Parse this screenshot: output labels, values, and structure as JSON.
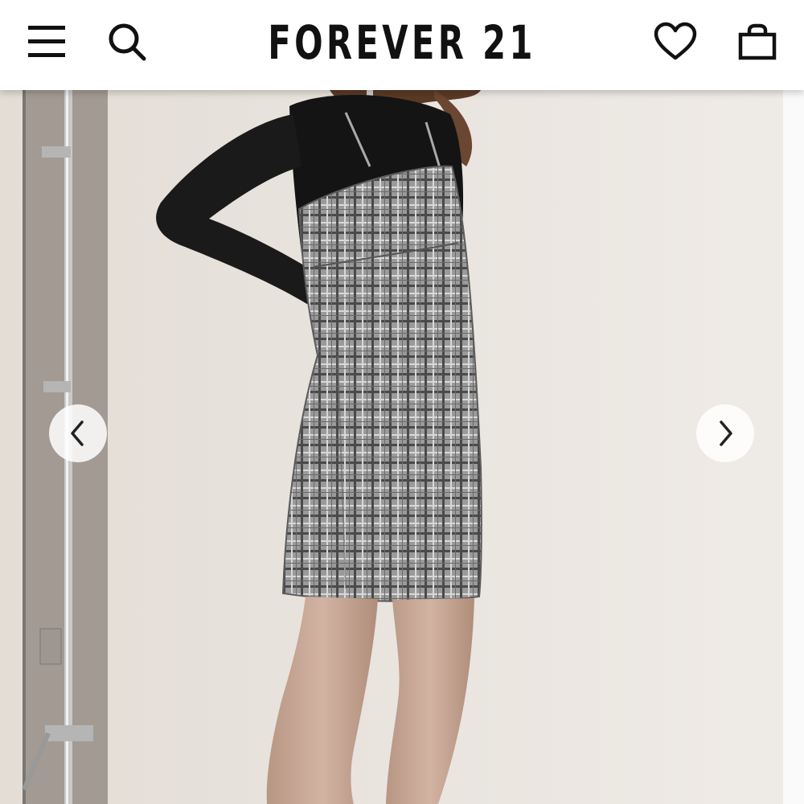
{
  "header": {
    "brand": "FOREVER 21",
    "icons": {
      "menu": "hamburger-menu-icon",
      "search": "search-icon",
      "wishlist": "heart-icon",
      "bag": "shopping-bag-icon"
    }
  },
  "product_image": {
    "description_colors": {
      "background": "#ebe6e0",
      "top": "#111111",
      "dress": "#8a8a8a"
    }
  },
  "carousel": {
    "prev_icon": "chevron-left-icon",
    "next_icon": "chevron-right-icon"
  }
}
